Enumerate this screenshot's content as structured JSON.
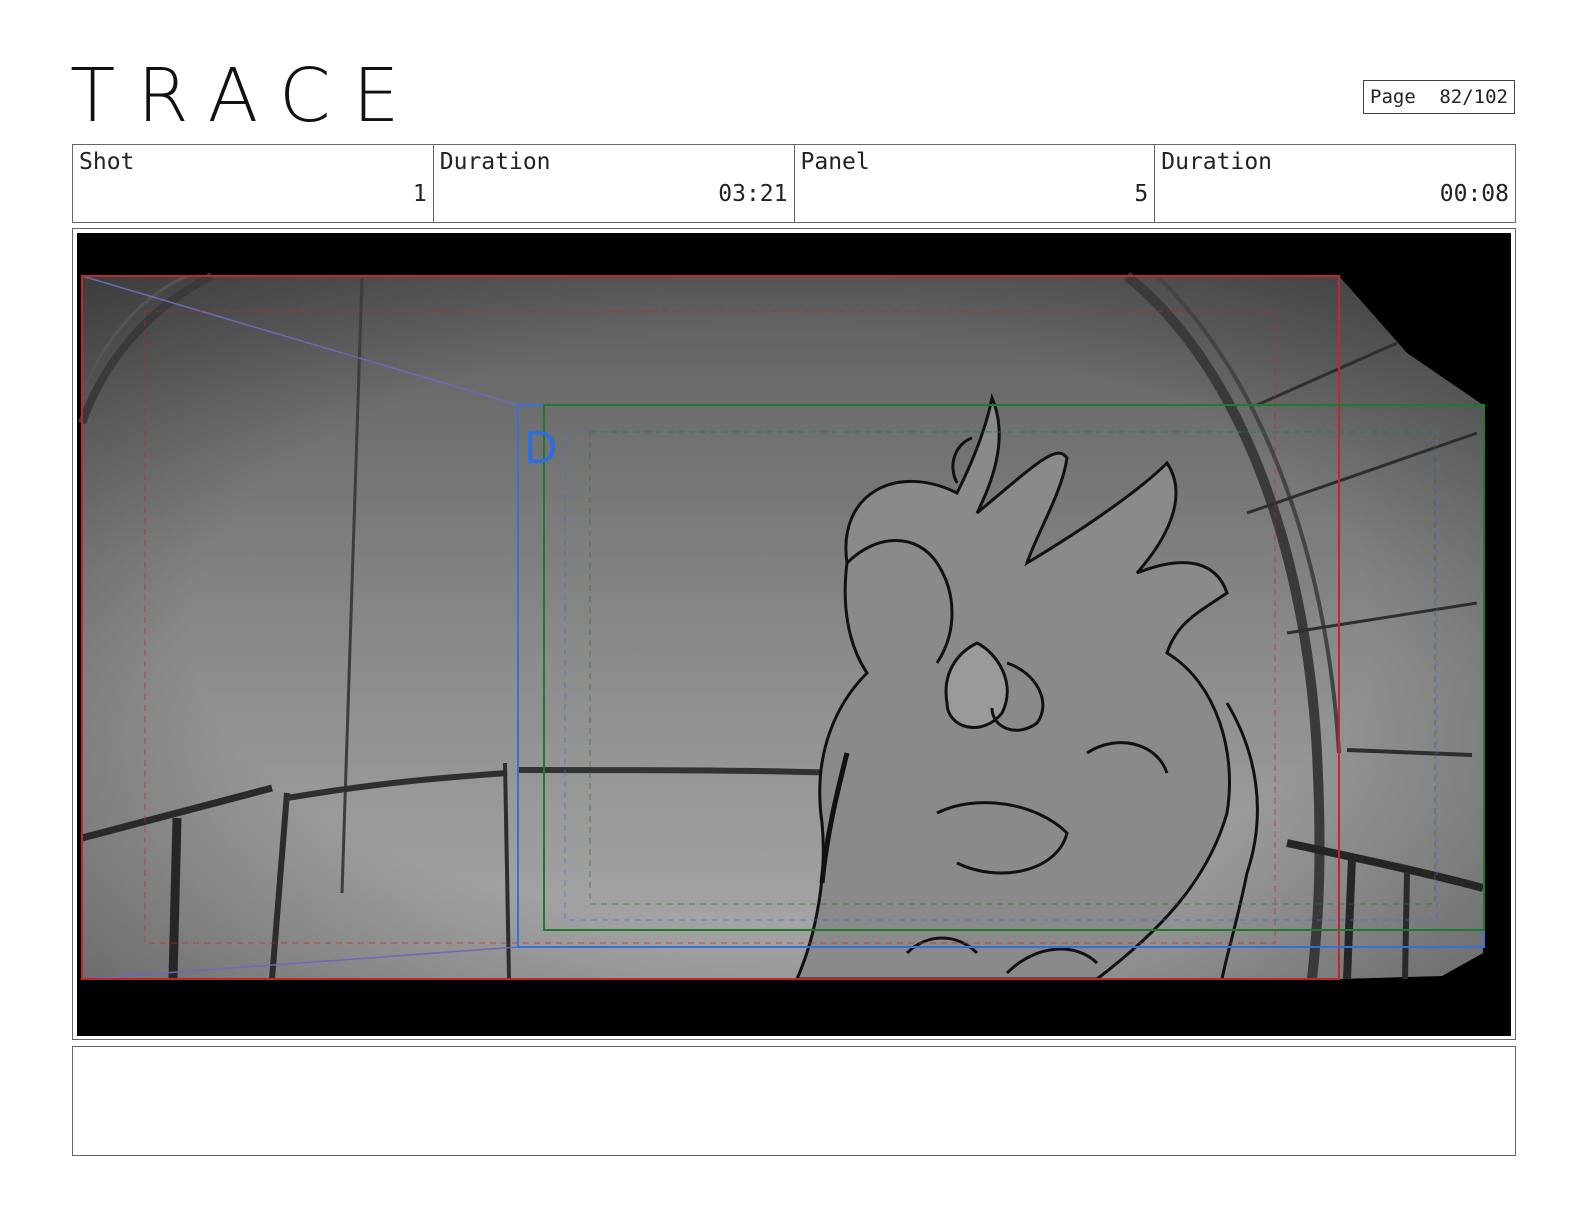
{
  "header": {
    "logo_text": "TRACE",
    "page_label": "Page",
    "page_value": "82/102"
  },
  "info": {
    "shot_label": "Shot",
    "shot_value": "1",
    "shot_duration_label": "Duration",
    "shot_duration_value": "03:21",
    "panel_label": "Panel",
    "panel_value": "5",
    "panel_duration_label": "Duration",
    "panel_duration_value": "00:08"
  },
  "panel": {
    "camera_marker": "D"
  },
  "notes": {
    "text": ""
  },
  "colors": {
    "camera_frame": "#c0282d",
    "camera_frame_end": "#1f7a2e",
    "camera_frame_alt": "#3a6fd8",
    "letterbox": "#000000"
  }
}
